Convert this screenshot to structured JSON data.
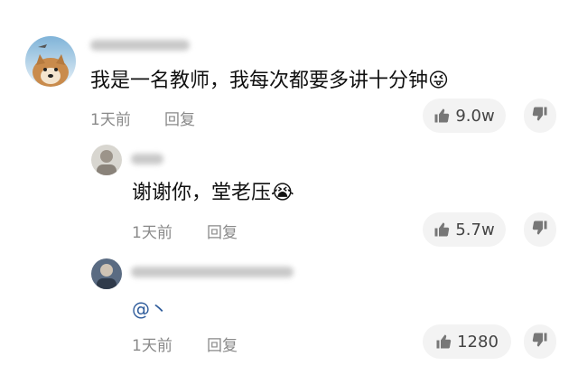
{
  "comments": [
    {
      "id": "c1",
      "text": "我是一名教师，我每次都要多讲十分钟",
      "emoji": "😜",
      "time": "1天前",
      "reply_label": "回复",
      "likes": "9.0w"
    },
    {
      "id": "c2",
      "text": "谢谢你，堂老压",
      "emoji": "😭",
      "time": "1天前",
      "reply_label": "回复",
      "likes": "5.7w"
    },
    {
      "id": "c3",
      "mention_text": "@丶",
      "time": "1天前",
      "reply_label": "回复",
      "likes": "1280"
    }
  ],
  "icons": {
    "like": "thumbs-up-icon",
    "dislike": "thumbs-down-icon"
  },
  "colors": {
    "meta": "#8a8a8a",
    "mention": "#2f5c9b",
    "pill_bg": "#f3f3f3"
  }
}
